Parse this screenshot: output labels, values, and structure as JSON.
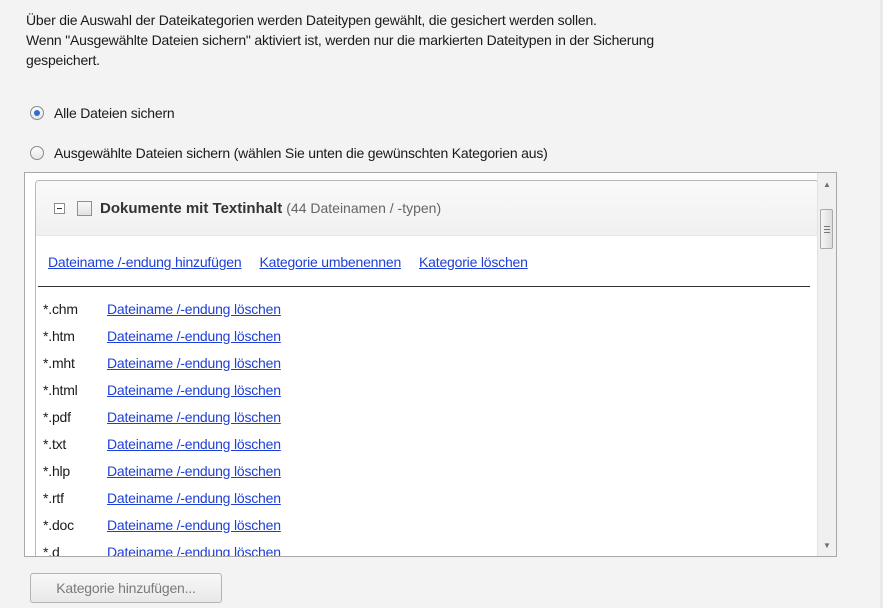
{
  "intro": {
    "line1": "Über die Auswahl der Dateikategorien werden Dateitypen gewählt, die gesichert werden sollen.",
    "line2": "Wenn \"Ausgewählte Dateien sichern\" aktiviert ist, werden nur die markierten Dateitypen in der Sicherung",
    "line3": "gespeichert."
  },
  "options": {
    "all_label": "Alle Dateien sichern",
    "selected_label": "Ausgewählte Dateien sichern (wählen Sie unten die gewünschten Kategorien aus)",
    "checked": "all"
  },
  "category": {
    "title": "Dokumente mit Textinhalt",
    "count": "(44 Dateinamen / -typen)",
    "checked": false,
    "actions": {
      "add": "Dateiname /-endung hinzufügen",
      "rename": "Kategorie umbenennen",
      "delete": "Kategorie löschen"
    },
    "files": [
      {
        "ext": "*.chm",
        "action": "Dateiname /-endung löschen"
      },
      {
        "ext": "*.htm",
        "action": "Dateiname /-endung löschen"
      },
      {
        "ext": "*.mht",
        "action": "Dateiname /-endung löschen"
      },
      {
        "ext": "*.html",
        "action": "Dateiname /-endung löschen"
      },
      {
        "ext": "*.pdf",
        "action": "Dateiname /-endung löschen"
      },
      {
        "ext": "*.txt",
        "action": "Dateiname /-endung löschen"
      },
      {
        "ext": "*.hlp",
        "action": "Dateiname /-endung löschen"
      },
      {
        "ext": "*.rtf",
        "action": "Dateiname /-endung löschen"
      },
      {
        "ext": "*.doc",
        "action": "Dateiname /-endung löschen"
      },
      {
        "ext": "*.d",
        "action": "Dateiname /-endung löschen"
      }
    ]
  },
  "scrollbar": {
    "up_icon": "triangle-up-icon",
    "down_icon": "triangle-down-icon"
  },
  "add_category_button": "Kategorie hinzufügen..."
}
